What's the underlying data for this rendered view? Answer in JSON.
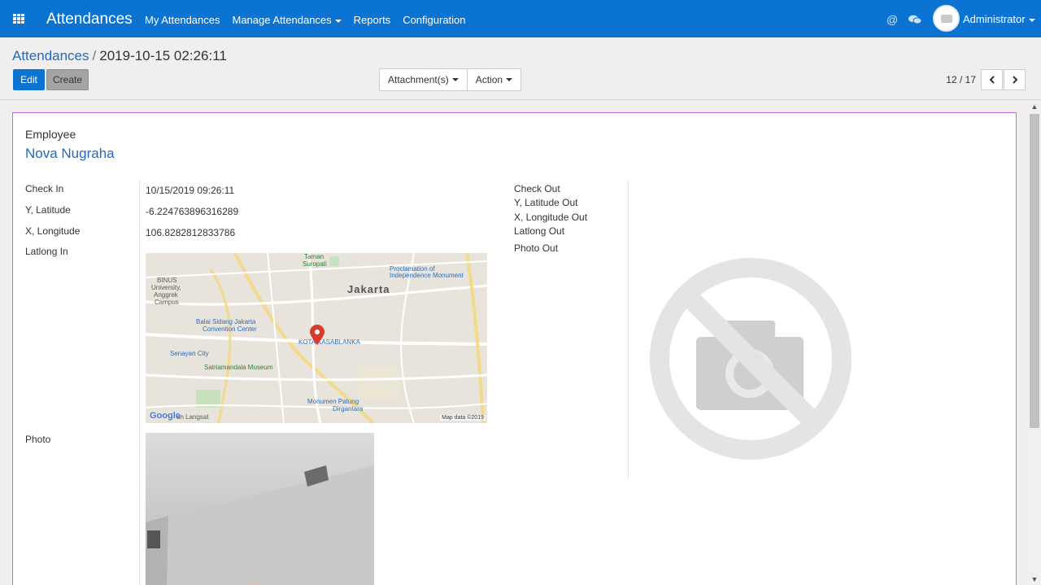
{
  "navbar": {
    "app_title": "Attendances",
    "menu": [
      "My Attendances",
      "Manage Attendances",
      "Reports",
      "Configuration"
    ],
    "user": "Administrator"
  },
  "breadcrumb": {
    "parent": "Attendances",
    "separator": "/",
    "current": "2019-10-15 02:26:11"
  },
  "buttons": {
    "edit": "Edit",
    "create": "Create",
    "attachments": "Attachment(s)",
    "action": "Action"
  },
  "pager": {
    "value": "12 / 17"
  },
  "form": {
    "employee_label": "Employee",
    "employee_name": "Nova Nugraha",
    "check_in_label": "Check In",
    "check_in_value": "10/15/2019 09:26:11",
    "latitude_label": "Y, Latitude",
    "latitude_value": "-6.224763896316289",
    "longitude_label": "X, Longitude",
    "longitude_value": "106.8282812833786",
    "latlong_in_label": "Latlong In",
    "photo_label": "Photo",
    "check_out_label": "Check Out",
    "latitude_out_label": "Y, Latitude Out",
    "longitude_out_label": "X, Longitude Out",
    "latlong_out_label": "Latlong Out",
    "photo_out_label": "Photo Out"
  },
  "map": {
    "city": "Jakarta",
    "places": {
      "taman": "Taman",
      "suropati": "Suropati",
      "proclamation": "Proclamation of",
      "monument": "Independence Monument",
      "binus1": "BINUS",
      "binus2": "University,",
      "binus3": "Anggrek",
      "binus4": "Campus",
      "balai1": "Balai Sidang Jakarta",
      "balai2": "Convention Center",
      "kota": "KOTA KASABLANKA",
      "senayan": "Senayan City",
      "satria": "Satriamandala Museum",
      "monumen1": "Monumen Patung",
      "monumen2": "Dirgantara",
      "langsat": "an Langsat"
    },
    "google": "Google",
    "credit": "Map data ©2019"
  },
  "icons": {
    "apps": "apps-grid-icon",
    "mention": "at-icon",
    "chat": "chat-icon",
    "map_pin": "map-pin-icon",
    "no_photo": "no-camera-icon",
    "prev": "chevron-left-icon",
    "next": "chevron-right-icon"
  },
  "colors": {
    "navbar": "#0b73d1",
    "link": "#1e6bbf",
    "sheet_border": "#b86ddc",
    "pin": "#d93a2e"
  }
}
